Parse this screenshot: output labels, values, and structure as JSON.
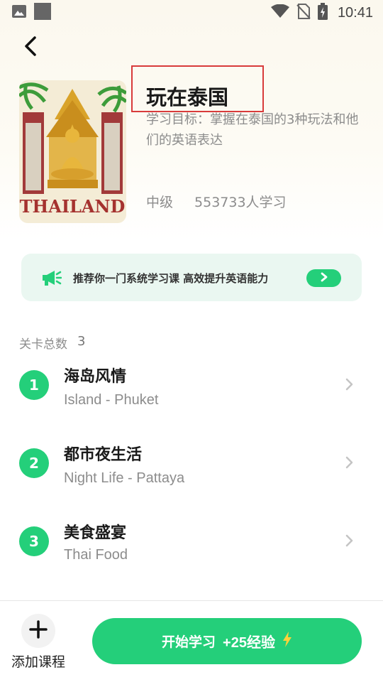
{
  "status_bar": {
    "time": "10:41",
    "left_icons": [
      "image-icon",
      "app-square-icon"
    ],
    "right_icons": [
      "wifi-icon",
      "no-sim-icon",
      "battery-charging-icon"
    ]
  },
  "course": {
    "title": "玩在泰国",
    "goal": "学习目标：掌握在泰国的3种玩法和他们的英语表达",
    "level": "中级",
    "learners": "553733人学习",
    "cover_text": "THAILAND"
  },
  "promo": {
    "text": "推荐你一门系统学习课  高效提升英语能力"
  },
  "levels": {
    "count_label": "关卡总数",
    "count": "3",
    "items": [
      {
        "number": "1",
        "title": "海岛风情",
        "subtitle": "Island - Phuket"
      },
      {
        "number": "2",
        "title": "都市夜生活",
        "subtitle": "Night Life - Pattaya"
      },
      {
        "number": "3",
        "title": "美食盛宴",
        "subtitle": "Thai Food"
      }
    ]
  },
  "bottom": {
    "add_label": "添加课程",
    "start_label": "开始学习",
    "xp_label": "+25经验"
  },
  "colors": {
    "accent": "#24cf7a",
    "highlight_box": "#d83b3b",
    "promo_bg": "#eaf7f1"
  }
}
